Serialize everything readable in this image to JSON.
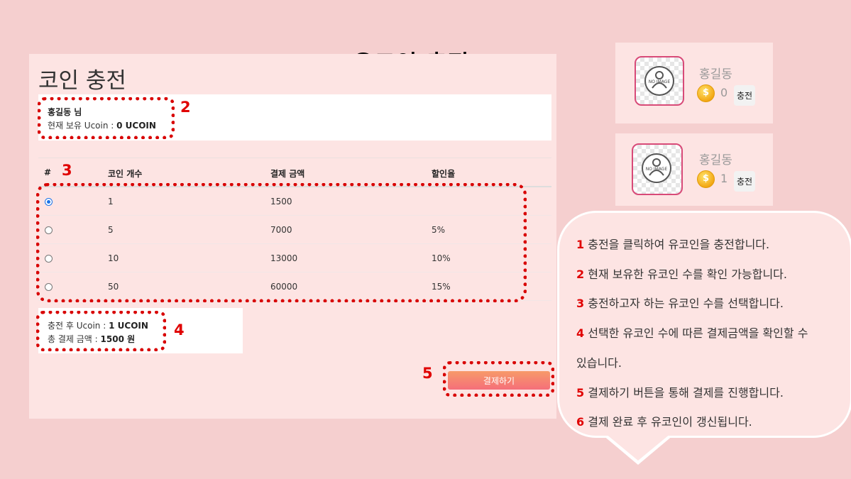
{
  "slide_title": "유코인 충전",
  "panel": {
    "title": "코인 충전",
    "user_name": "홍길동 님",
    "coin_label": "현재 보유 Ucoin :",
    "coin_value": "0 UCOIN"
  },
  "table": {
    "headers": [
      "#",
      "코인 개수",
      "결제 금액",
      "할인율"
    ],
    "rows": [
      {
        "selected": true,
        "coins": "1",
        "price": "1500",
        "discount": ""
      },
      {
        "selected": false,
        "coins": "5",
        "price": "7000",
        "discount": "5%"
      },
      {
        "selected": false,
        "coins": "10",
        "price": "13000",
        "discount": "10%"
      },
      {
        "selected": false,
        "coins": "50",
        "price": "60000",
        "discount": "15%"
      }
    ]
  },
  "result": {
    "after_label": "충전 후 Ucoin :",
    "after_value": "1 UCOIN",
    "total_label": "총 결제 금액 :",
    "total_value": "1500 원"
  },
  "pay_button": "결제하기",
  "profile_cards": [
    {
      "avatar_text": "NO IMAGE",
      "name": "홍길동",
      "coins": "0",
      "charge_label": "충전"
    },
    {
      "avatar_text": "NO IMAGE",
      "name": "홍길동",
      "coins": "1",
      "charge_label": "충전"
    }
  ],
  "markers": [
    "1",
    "2",
    "3",
    "4",
    "5",
    "6"
  ],
  "help_items": [
    {
      "num": "1",
      "text": "충전을 클릭하여 유코인을 충전합니다."
    },
    {
      "num": "2",
      "text": "현재 보유한 유코인 수를 확인 가능합니다."
    },
    {
      "num": "3",
      "text": "충전하고자 하는 유코인 수를 선택합니다."
    },
    {
      "num": "4",
      "text": "선택한 유코인 수에 따른 결제금액을 확인할 수"
    },
    {
      "num": "",
      "text": "있습니다."
    },
    {
      "num": "5",
      "text": "결제하기 버튼을 통해 결제를 진행합니다."
    },
    {
      "num": "6",
      "text": "결제 완료 후 유코인이 갱신됩니다."
    }
  ],
  "colors": {
    "accent_red": "#e00000",
    "panel_bg": "#fde4e3",
    "page_bg": "#f5cfcf",
    "button_gradient": [
      "#f79a69",
      "#f56f7a"
    ]
  }
}
